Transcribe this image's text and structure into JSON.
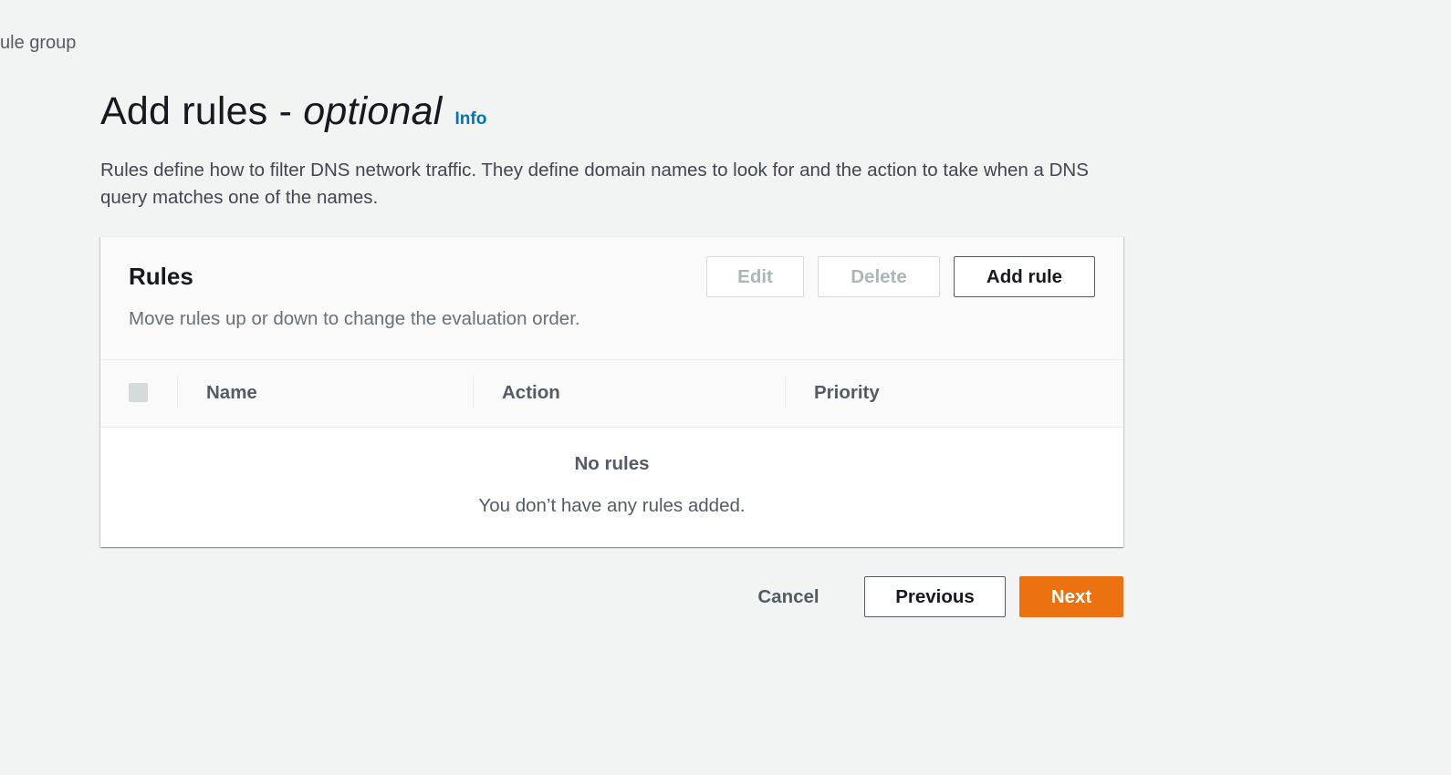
{
  "breadcrumb": {
    "label": "ule group"
  },
  "header": {
    "title": "Add rules - ",
    "title_italic": "optional",
    "info_label": "Info",
    "description": "Rules define how to filter DNS network traffic. They define domain names to look for and the action to take when a DNS query matches one of the names."
  },
  "rules_panel": {
    "title": "Rules",
    "subtitle": "Move rules up or down to change the evaluation order.",
    "edit_label": "Edit",
    "delete_label": "Delete",
    "add_label": "Add rule",
    "columns": [
      "Name",
      "Action",
      "Priority"
    ],
    "empty_title": "No rules",
    "empty_message": "You don’t have any rules added."
  },
  "footer": {
    "cancel_label": "Cancel",
    "previous_label": "Previous",
    "next_label": "Next"
  },
  "colors": {
    "primary": "#ec7211",
    "link": "#0073bb",
    "background": "#f2f3f3"
  }
}
